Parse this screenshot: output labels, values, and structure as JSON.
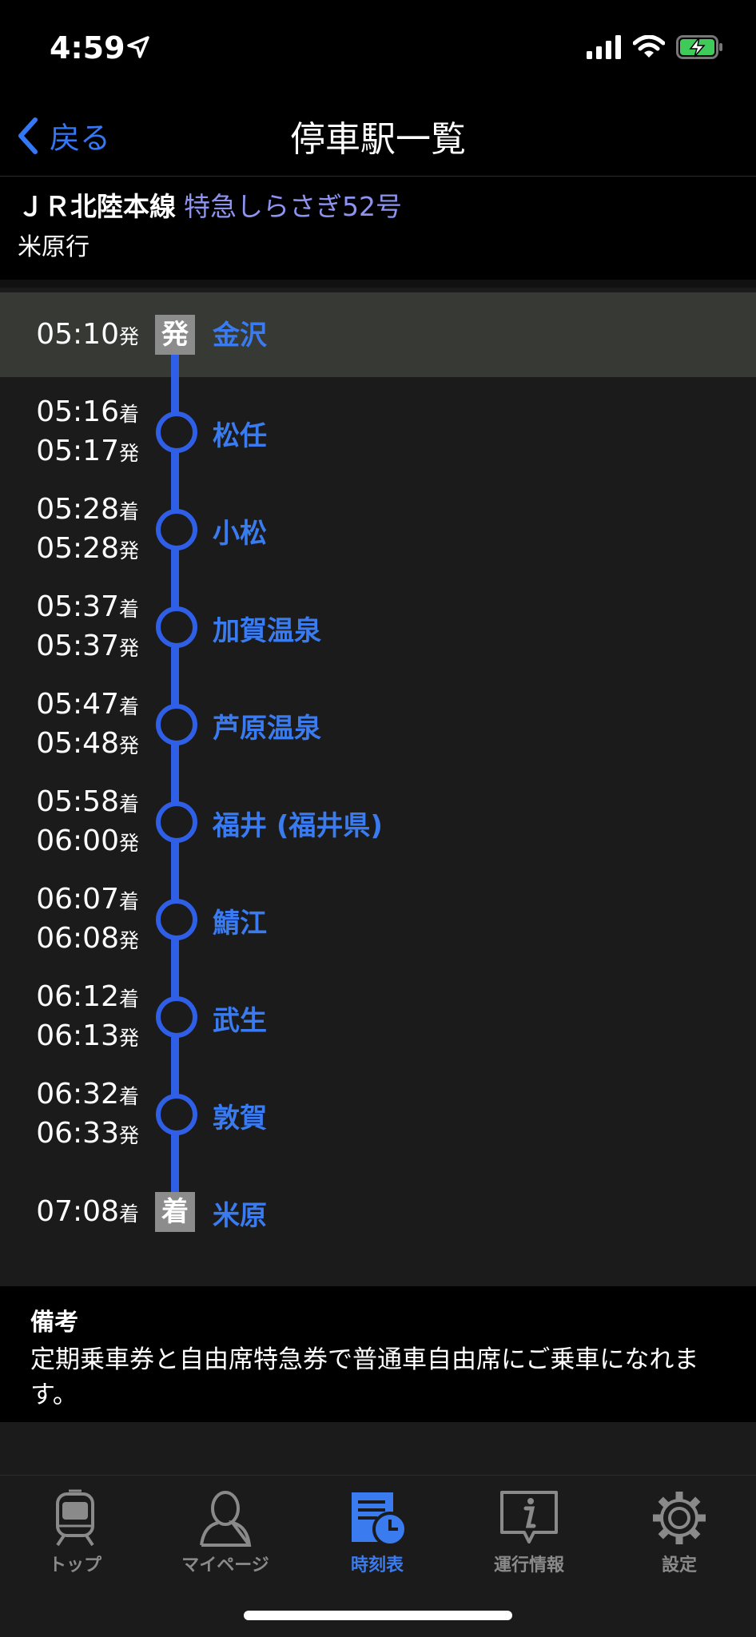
{
  "status": {
    "time": "4:59"
  },
  "nav": {
    "back_label": "戻る",
    "title": "停車駅一覧"
  },
  "train": {
    "line": "ＪＲ北陸本線",
    "name": "特急しらさぎ52号",
    "destination": "米原行"
  },
  "labels": {
    "arr_suffix": "着",
    "dep_suffix": "発",
    "dep_badge": "発",
    "arr_badge": "着"
  },
  "stops": [
    {
      "name": "金沢",
      "dep": "05:10"
    },
    {
      "name": "松任",
      "arr": "05:16",
      "dep": "05:17"
    },
    {
      "name": "小松",
      "arr": "05:28",
      "dep": "05:28"
    },
    {
      "name": "加賀温泉",
      "arr": "05:37",
      "dep": "05:37"
    },
    {
      "name": "芦原温泉",
      "arr": "05:47",
      "dep": "05:48"
    },
    {
      "name": "福井 (福井県)",
      "arr": "05:58",
      "dep": "06:00"
    },
    {
      "name": "鯖江",
      "arr": "06:07",
      "dep": "06:08"
    },
    {
      "name": "武生",
      "arr": "06:12",
      "dep": "06:13"
    },
    {
      "name": "敦賀",
      "arr": "06:32",
      "dep": "06:33"
    },
    {
      "name": "米原",
      "arr": "07:08"
    }
  ],
  "remarks": {
    "title": "備考",
    "text": "定期乗車券と自由席特急券で普通車自由席にご乗車になれます。"
  },
  "tabs": [
    {
      "label": "トップ",
      "icon": "train-icon"
    },
    {
      "label": "マイページ",
      "icon": "person-icon"
    },
    {
      "label": "時刻表",
      "icon": "timetable-icon"
    },
    {
      "label": "運行情報",
      "icon": "info-icon"
    },
    {
      "label": "設定",
      "icon": "gear-icon"
    }
  ],
  "colors": {
    "accent": "#3a7bf0",
    "line": "#2e5fe6",
    "train_name": "#8e93f0"
  }
}
